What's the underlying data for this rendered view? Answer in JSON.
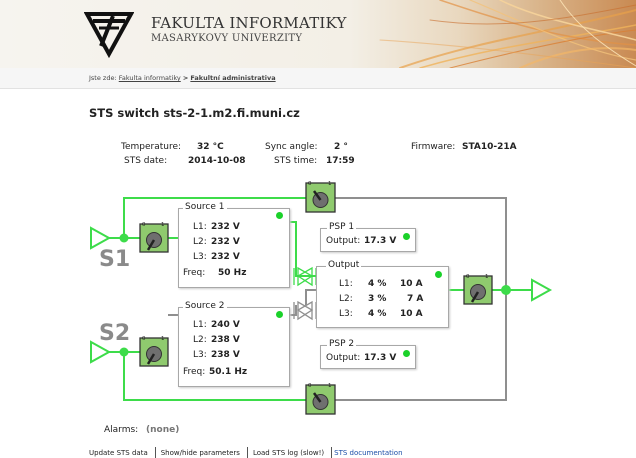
{
  "header": {
    "faculty_name": "FAKULTA INFORMATIKY",
    "university_name": "MASARYKOVY UNIVERZITY"
  },
  "breadcrumb": {
    "prefix": "Jste zde:",
    "link1": "Fakulta informatiky",
    "separator": ">",
    "current": "Fakultní administrativa"
  },
  "page": {
    "title": "STS switch sts-2-1.m2.fi.muni.cz"
  },
  "info": {
    "temperature_label": "Temperature:",
    "temperature_value": "32 °C",
    "sync_label": "Sync angle:",
    "sync_value": "2 °",
    "firmware_label": "Firmware:",
    "firmware_value": "STA10-21A",
    "date_label": "STS date:",
    "date_value": "2014-10-08",
    "time_label": "STS time:",
    "time_value": "17:59"
  },
  "diagram": {
    "colors": {
      "active": "#3ddc4a",
      "inactive": "#8f8f8f",
      "switch_fill": "#8fca6e",
      "status_ok": "#1bd12a"
    },
    "source1": {
      "title": "Source 1",
      "name": "S1",
      "l1_label": "L1:",
      "l1": "232 V",
      "l2_label": "L2:",
      "l2": "232 V",
      "l3_label": "L3:",
      "l3": "232 V",
      "freq_label": "Freq:",
      "freq": "50 Hz"
    },
    "source2": {
      "title": "Source 2",
      "name": "S2",
      "l1_label": "L1:",
      "l1": "240 V",
      "l2_label": "L2:",
      "l2": "238 V",
      "l3_label": "L3:",
      "l3": "238 V",
      "freq_label": "Freq:",
      "freq": "50.1 Hz"
    },
    "psp1": {
      "title": "PSP 1",
      "output_label": "Output:",
      "output": "17.3 V"
    },
    "psp2": {
      "title": "PSP 2",
      "output_label": "Output:",
      "output": "17.3 V"
    },
    "output": {
      "title": "Output",
      "rows": [
        {
          "label": "L1:",
          "pct": "4 %",
          "amp": "10 A"
        },
        {
          "label": "L2:",
          "pct": "3 %",
          "amp": "7 A"
        },
        {
          "label": "L3:",
          "pct": "4 %",
          "amp": "10 A"
        }
      ]
    },
    "switch_label_off": "0",
    "switch_label_on": "1"
  },
  "alarms": {
    "label": "Alarms:",
    "value": "(none)"
  },
  "toolbar": {
    "update": "Update STS data",
    "toggle": "Show/hide parameters",
    "load_log": "Load STS log (slow!)",
    "docs": "STS documentation"
  }
}
